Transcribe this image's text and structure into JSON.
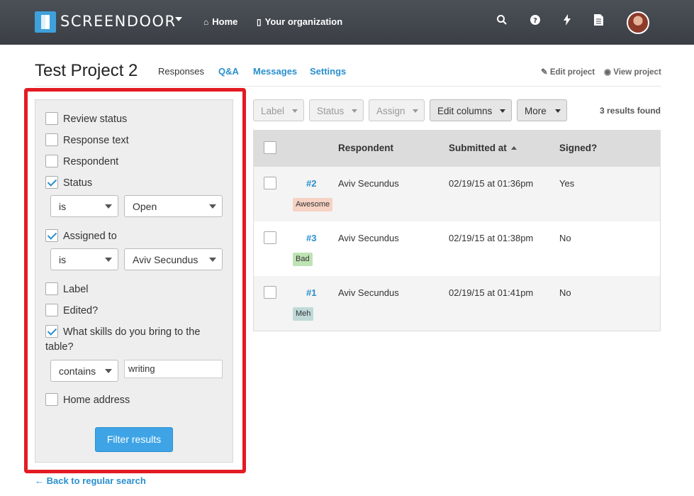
{
  "topbar": {
    "brand": "SCREENDOOR",
    "nav": [
      {
        "label": "Home",
        "icon": "home-icon"
      },
      {
        "label": "Your organization",
        "icon": "building-icon"
      }
    ],
    "icons": [
      "search-icon",
      "help-icon",
      "bolt-icon",
      "document-icon"
    ]
  },
  "header": {
    "title": "Test Project 2",
    "tabs": [
      "Responses",
      "Q&A",
      "Messages",
      "Settings"
    ],
    "edit_project": "Edit project",
    "view_project": "View project"
  },
  "filters": {
    "review_status": "Review status",
    "response_text": "Response text",
    "respondent": "Respondent",
    "status": "Status",
    "status_op": "is",
    "status_value": "Open",
    "assigned_to": "Assigned to",
    "assigned_op": "is",
    "assigned_value": "Aviv Secundus",
    "label": "Label",
    "edited": "Edited?",
    "skills_line1": "What skills do you bring to the",
    "skills_line2": "table?",
    "skills_op": "contains",
    "skills_value": "writing",
    "home_address": "Home address",
    "submit": "Filter results"
  },
  "back_link": "← Back to regular search",
  "toolbar": {
    "label": "Label",
    "status": "Status",
    "assign": "Assign",
    "edit_columns": "Edit columns",
    "more": "More",
    "results": "3 results found"
  },
  "table": {
    "columns": [
      "Respondent",
      "Submitted at",
      "Signed?"
    ],
    "rows": [
      {
        "id": "#2",
        "respondent": "Aviv Secundus",
        "submitted": "02/19/15 at 01:36pm",
        "signed": "Yes",
        "tag": "Awesome",
        "tag_color": "#f6d3c4"
      },
      {
        "id": "#3",
        "respondent": "Aviv Secundus",
        "submitted": "02/19/15 at 01:38pm",
        "signed": "No",
        "tag": "Bad",
        "tag_color": "#bfe3b4"
      },
      {
        "id": "#1",
        "respondent": "Aviv Secundus",
        "submitted": "02/19/15 at 01:41pm",
        "signed": "No",
        "tag": "Meh",
        "tag_color": "#bfd9d8"
      }
    ]
  },
  "colors": {
    "accent": "#2a8fce",
    "highlight": "#e31b23",
    "primary_button": "#3ea4e6"
  }
}
